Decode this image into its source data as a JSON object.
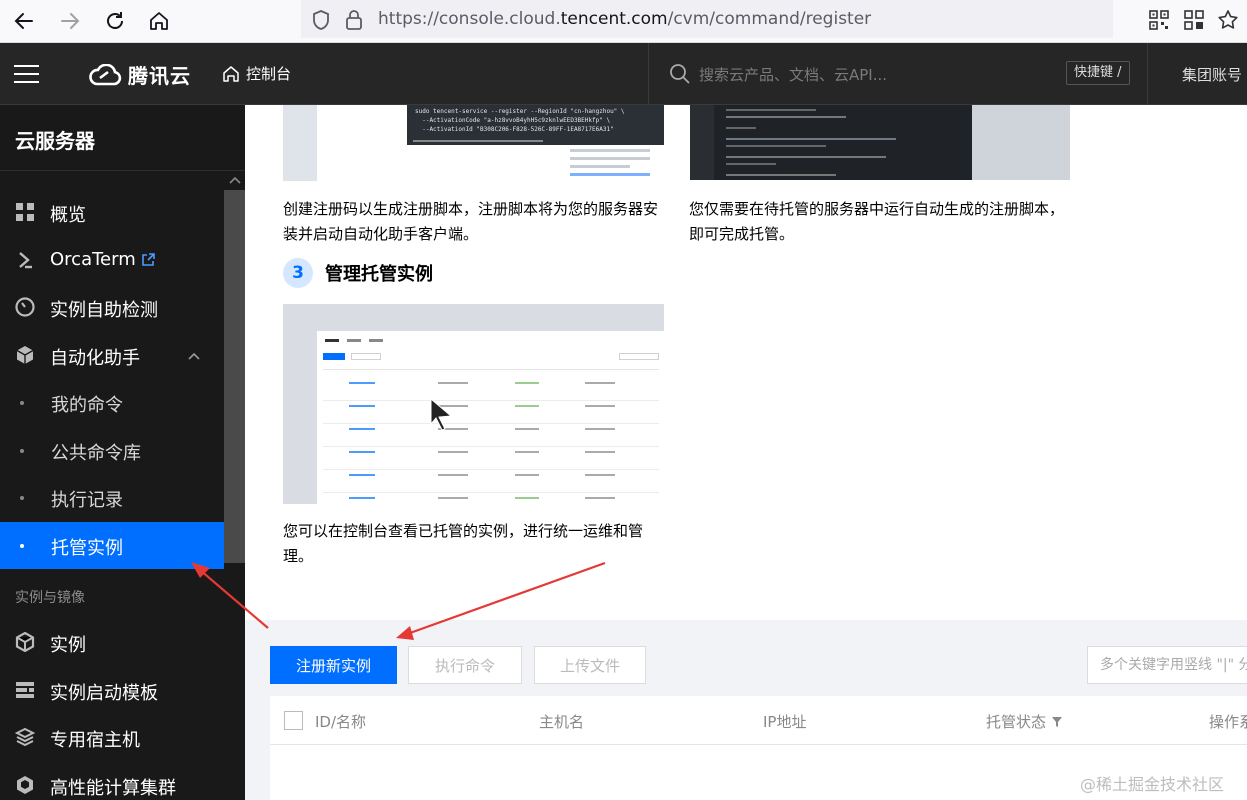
{
  "browser": {
    "url_prefix": "https://console.cloud.",
    "url_domain": "tencent.com",
    "url_path": "/cvm/command/register"
  },
  "topbar": {
    "brand": "腾讯云",
    "console": "控制台",
    "search_placeholder": "搜索云产品、文档、云API...",
    "hotkey": "快捷键 /",
    "account": "集团账号"
  },
  "sidebar": {
    "title": "云服务器",
    "items": [
      {
        "label": "概览",
        "icon": "grid-icon"
      },
      {
        "label": "OrcaTerm",
        "icon": "terminal-icon"
      },
      {
        "label": "实例自助检测",
        "icon": "gauge-icon"
      },
      {
        "label": "自动化助手",
        "icon": "robot-icon"
      },
      {
        "label": "我的命令"
      },
      {
        "label": "公共命令库"
      },
      {
        "label": "执行记录"
      },
      {
        "label": "托管实例"
      },
      {
        "label": "实例",
        "icon": "cube-icon"
      },
      {
        "label": "实例启动模板",
        "icon": "template-icon"
      },
      {
        "label": "专用宿主机",
        "icon": "layers-icon"
      },
      {
        "label": "高性能计算集群",
        "icon": "cluster-icon"
      }
    ],
    "group_label": "实例与镜像"
  },
  "guide": {
    "caption_1": "创建注册码以生成注册脚本，注册脚本将为您的服务器安装并启动自动化助手客户端。",
    "caption_2": "您仅需要在待托管的服务器中运行自动生成的注册脚本，即可完成托管。",
    "step_number": "3",
    "step_title": "管理托管实例",
    "caption_3": "您可以在控制台查看已托管的实例，进行统一运维和管理。",
    "terminal_lines": [
      "sudo tencent-service --register --RegionId \"cn-hangzhou\" \\",
      "  --ActivationCode \"a-hz8vvoB4yhH5c9zknlwEED3BEHkfp\" \\",
      "  --ActivationId \"B308C206-F828-526C-89FF-1EA8717E6A31\""
    ]
  },
  "toolbar": {
    "register_button": "注册新实例",
    "run_command_button": "执行命令",
    "upload_file_button": "上传文件",
    "filter_placeholder": "多个关键字用竖线 \"|\" 分"
  },
  "table": {
    "columns": [
      "ID/名称",
      "主机名",
      "IP地址",
      "托管状态",
      "操作系"
    ]
  },
  "watermark": "@稀土掘金技术社区",
  "colors": {
    "primary": "#006eff",
    "sidebar_bg": "#191919",
    "topbar_bg": "#262626",
    "arrow": "#e53935"
  }
}
